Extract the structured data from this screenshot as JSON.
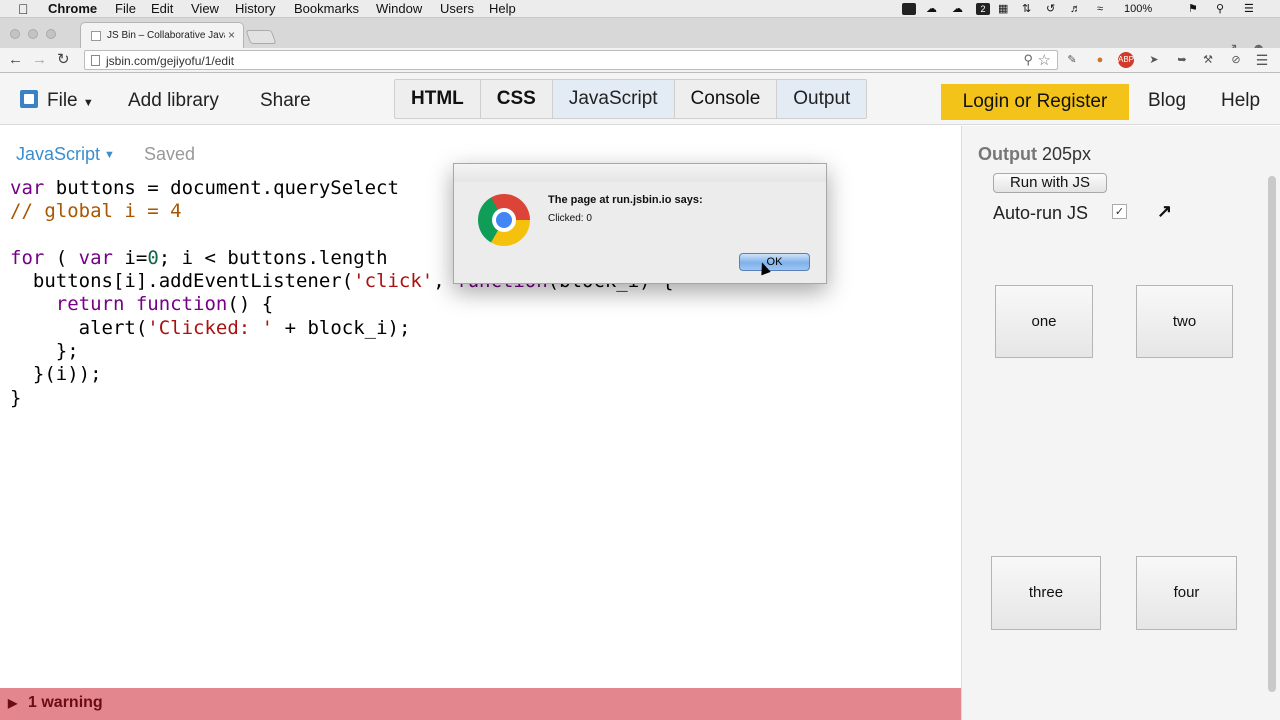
{
  "os_menubar": {
    "app": "Chrome",
    "menus": [
      "File",
      "Edit",
      "View",
      "History",
      "Bookmarks",
      "Window",
      "Users",
      "Help"
    ],
    "battery": "100%"
  },
  "browser": {
    "tab_title": "JS Bin – Collaborative JavaS",
    "url": "jsbin.com/gejiyofu/1/edit"
  },
  "jsbin_nav": {
    "file": "File",
    "add_library": "Add library",
    "share": "Share",
    "panels": [
      "HTML",
      "CSS",
      "JavaScript",
      "Console",
      "Output"
    ],
    "login": "Login or Register",
    "blog": "Blog",
    "help": "Help"
  },
  "editor": {
    "panel_name": "JavaScript",
    "status": "Saved"
  },
  "warning_bar": {
    "text": "1 warning"
  },
  "output_panel": {
    "title": "Output",
    "width_label": "205px",
    "run_button": "Run with JS",
    "autorun_label": "Auto-run JS",
    "autorun_checked": true,
    "buttons": [
      "one",
      "two",
      "three",
      "four"
    ]
  },
  "dialog": {
    "title": "The page at run.jsbin.io says:",
    "message": "Clicked: 0",
    "ok": "OK"
  },
  "icons": {
    "chrome_logo": "chrome-logo-icon",
    "popout": "popout-arrow-icon"
  },
  "colors": {
    "login_bg": "#f3c31a",
    "warning_bg": "#e3868d",
    "panel_label": "#3a8ed0"
  }
}
